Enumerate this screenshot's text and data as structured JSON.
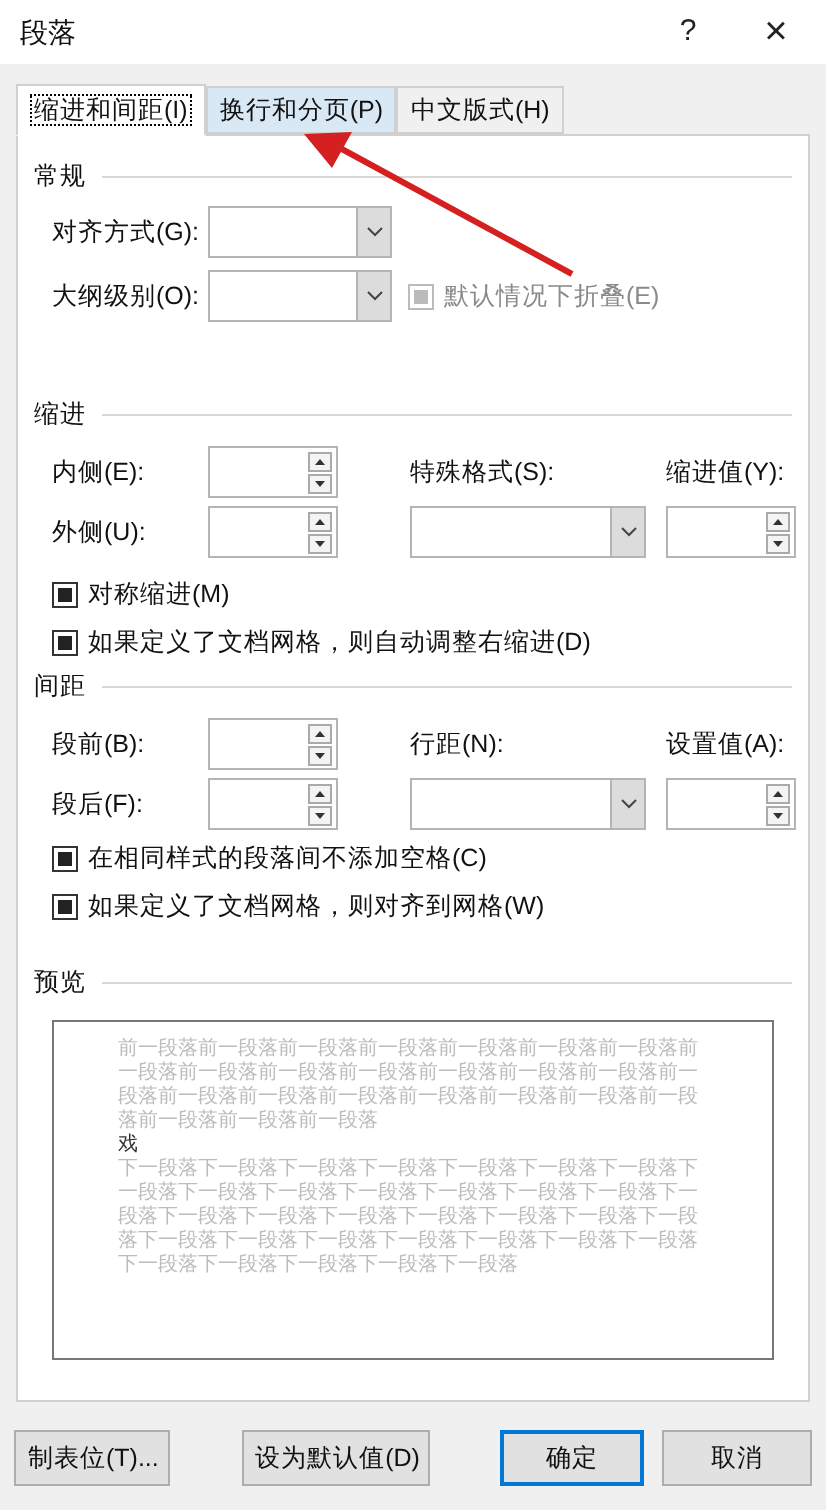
{
  "window": {
    "title": "段落",
    "help": "?",
    "close": "×"
  },
  "tabs": [
    {
      "label": "缩进和间距(I)",
      "selected": true
    },
    {
      "label": "换行和分页(P)",
      "selected": false
    },
    {
      "label": "中文版式(H)",
      "selected": false
    }
  ],
  "general": {
    "title": "常规",
    "alignment": {
      "label": "对齐方式(G):"
    },
    "outline_level": {
      "label": "大纲级别(O):"
    },
    "collapse": {
      "label": "默认情况下折叠(E)",
      "indeterminate": true,
      "disabled": true
    }
  },
  "indentation": {
    "title": "缩进",
    "inside": {
      "label": "内侧(E):"
    },
    "outside": {
      "label": "外侧(U):"
    },
    "special": {
      "label": "特殊格式(S):"
    },
    "by": {
      "label": "缩进值(Y):"
    },
    "checkboxes": [
      {
        "label": "对称缩进(M)",
        "indeterminate": true,
        "disabled": false
      },
      {
        "label": "如果定义了文档网格，则自动调整右缩进(D)",
        "indeterminate": true,
        "disabled": false
      }
    ]
  },
  "spacing": {
    "title": "间距",
    "before": {
      "label": "段前(B):"
    },
    "after": {
      "label": "段后(F):"
    },
    "line_spacing": {
      "label": "行距(N):"
    },
    "at": {
      "label": "设置值(A):"
    },
    "checkboxes": [
      {
        "label": "在相同样式的段落间不添加空格(C)",
        "indeterminate": true,
        "disabled": false
      },
      {
        "label": "如果定义了文档网格，则对齐到网格(W)",
        "indeterminate": true,
        "disabled": false
      }
    ]
  },
  "preview": {
    "title": "预览",
    "previous": "前一段落前一段落前一段落前一段落前一段落前一段落前一段落前一段落前一段落前一段落前一段落前一段落前一段落前一段落前一段落前一段落前一段落前一段落前一段落前一段落前一段落前一段落前一段落前一段落前一段落",
    "sample": "戏",
    "next": "下一段落下一段落下一段落下一段落下一段落下一段落下一段落下一段落下一段落下一段落下一段落下一段落下一段落下一段落下一段落下一段落下一段落下一段落下一段落下一段落下一段落下一段落下一段落下一段落下一段落下一段落下一段落下一段落下一段落下一段落下一段落下一段落下一段落下一段落"
  },
  "buttons": [
    {
      "label": "制表位(T)...",
      "kind": "normal"
    },
    {
      "label": "设为默认值(D)",
      "kind": "normal"
    },
    {
      "label": "确定",
      "kind": "default"
    },
    {
      "label": "取消",
      "kind": "normal"
    }
  ]
}
